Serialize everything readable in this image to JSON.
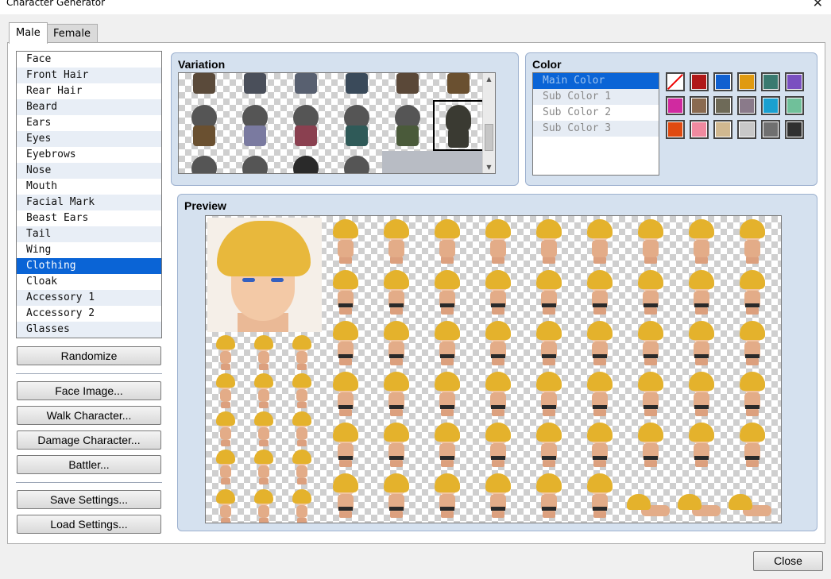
{
  "window": {
    "title": "Character Generator",
    "close_glyph": "✕"
  },
  "tabs": [
    {
      "label": "Male",
      "active": true
    },
    {
      "label": "Female",
      "active": false
    }
  ],
  "parts": {
    "items": [
      "Face",
      "Front Hair",
      "Rear Hair",
      "Beard",
      "Ears",
      "Eyes",
      "Eyebrows",
      "Nose",
      "Mouth",
      "Facial Mark",
      "Beast Ears",
      "Tail",
      "Wing",
      "Clothing",
      "Cloak",
      "Accessory 1",
      "Accessory 2",
      "Glasses"
    ],
    "selected": "Clothing"
  },
  "buttons": {
    "randomize": "Randomize",
    "face_image": "Face Image...",
    "walk_character": "Walk Character...",
    "damage_character": "Damage Character...",
    "battler": "Battler...",
    "save_settings": "Save Settings...",
    "load_settings": "Load Settings...",
    "close": "Close"
  },
  "variation": {
    "title": "Variation",
    "scroll_up_glyph": "▲",
    "scroll_down_glyph": "▼",
    "top_row_colors": [
      "#5a4a3a",
      "#4a4f5a",
      "#586070",
      "#3a4a5a",
      "#5a4838",
      "#6a5030"
    ],
    "middle_row_colors": [
      "#6a5030",
      "#7a7aa0",
      "#8a4050",
      "#2f5a58",
      "#4a5a3a"
    ],
    "selected_color": "#3a3a32"
  },
  "color": {
    "title": "Color",
    "items": [
      "Main Color",
      "Sub Color 1",
      "Sub Color 2",
      "Sub Color 3"
    ],
    "selected": "Main Color",
    "swatches": [
      "none",
      "#b01818",
      "#1060d0",
      "#e09a10",
      "#3a7a70",
      "#7a50c0",
      "#d02aa0",
      "#8a6a50",
      "#6e6a58",
      "#8a7a8a",
      "#1aa0d0",
      "#70c09a",
      "#e04a10",
      "#f08aa0",
      "#d0b890",
      "#c8c8c8",
      "#707070",
      "#303030"
    ]
  },
  "preview": {
    "title": "Preview",
    "hair_color": "#e4b22c",
    "skin_color": "#f1c4a0",
    "eye_color": "#3460c0"
  }
}
